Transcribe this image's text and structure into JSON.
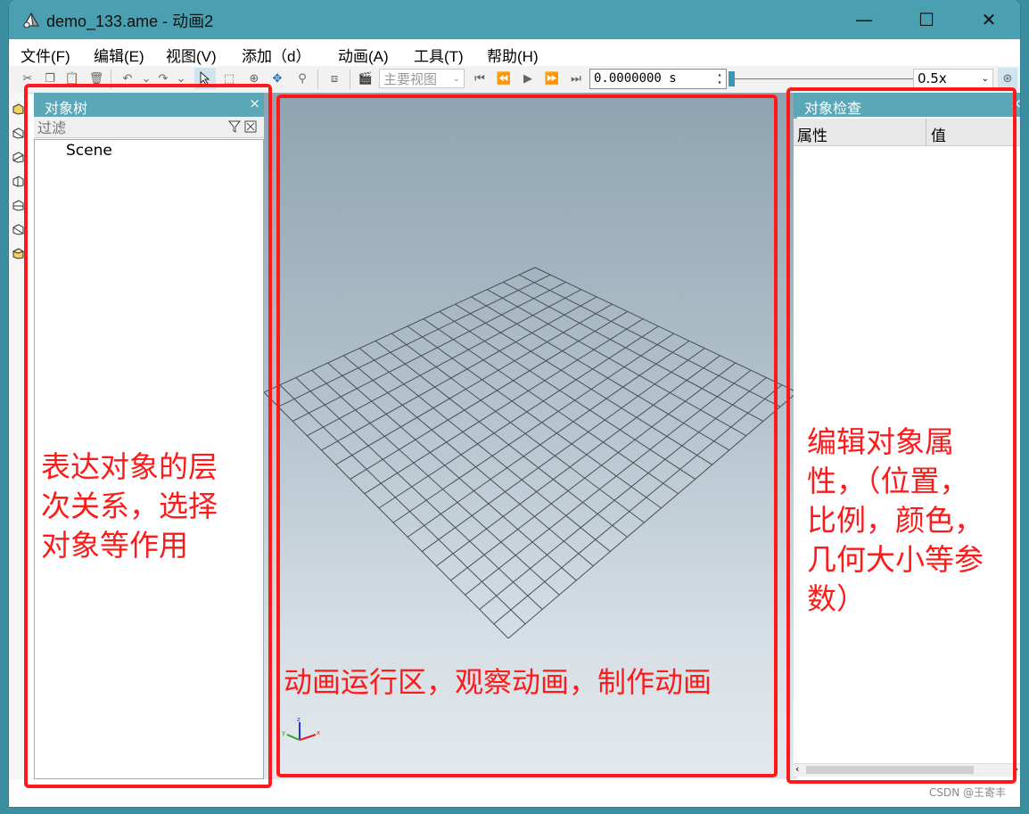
{
  "window": {
    "title": "demo_133.ame - 动画2",
    "controls": {
      "minimize": "—",
      "maximize": "☐",
      "close": "✕"
    }
  },
  "menu": [
    "文件(F)",
    "编辑(E)",
    "视图(V)",
    "添加（d）",
    "动画(A)",
    "工具(T)",
    "帮助(H)"
  ],
  "toolbar": {
    "view_select": "主要视图",
    "time_value": "0.0000000  s",
    "speed_select": "0.5x",
    "time_slider_fraction": 0
  },
  "object_tree": {
    "title": "对象树",
    "close": "×",
    "filter_placeholder": "过滤",
    "nodes": [
      "Scene"
    ]
  },
  "inspector": {
    "title": "对象检查",
    "close": "×",
    "col_property": "属性",
    "col_value": "值"
  },
  "annotations": {
    "left": [
      "表达对象的层",
      "次关系，选择",
      "对象等作用"
    ],
    "center": "动画运行区，观察动画，制作动画",
    "right": [
      "编辑对象属",
      "性，（位置，",
      "比例，颜色，",
      "几何大小等参",
      "数）"
    ]
  },
  "watermark": "CSDN @王寄丰",
  "accent_color": "#4a9fb0",
  "annotation_color": "#ff1a1a"
}
